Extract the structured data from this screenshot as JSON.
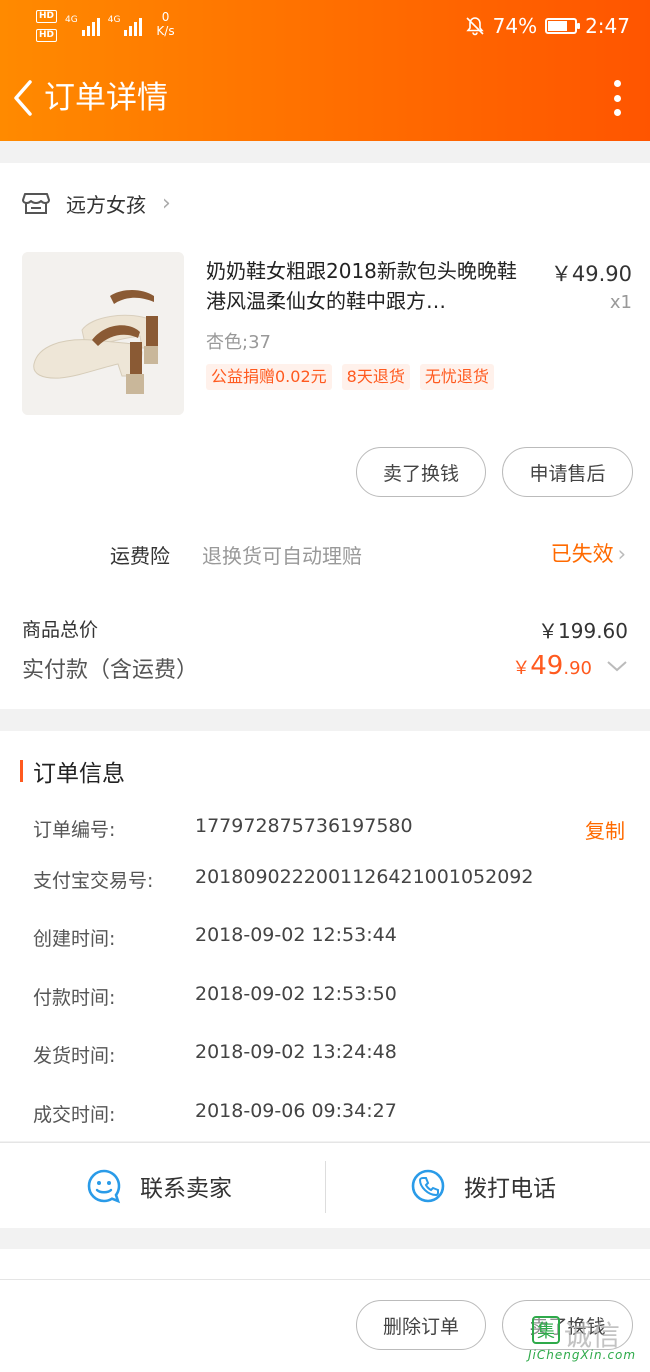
{
  "status_bar": {
    "hd1": "HD",
    "hd2": "HD",
    "net1": "4G",
    "net2": "4G",
    "speed_value": "0",
    "speed_unit": "K/s",
    "battery": "74%",
    "battery_level": 0.74,
    "time": "2:47"
  },
  "header": {
    "title": "订单详情"
  },
  "shop": {
    "name": "远方女孩"
  },
  "item": {
    "title": "奶奶鞋女粗跟2018新款包头晚晚鞋港风温柔仙女的鞋中跟方…",
    "price": "￥49.90",
    "qty": "x1",
    "spec": "杏色;37",
    "tags": [
      "公益捐赠0.02元",
      "8天退货",
      "无忧退货"
    ]
  },
  "item_actions": {
    "sell": "卖了换钱",
    "aftersale": "申请售后"
  },
  "insurance": {
    "label": "运费险",
    "desc": "退换货可自动理赔",
    "status": "已失效"
  },
  "totals": {
    "goods_label": "商品总价",
    "goods_value": "￥199.60",
    "paid_label": "实付款（含运费）",
    "paid_currency": "￥",
    "paid_int": "49",
    "paid_dec": ".90"
  },
  "order_info": {
    "title": "订单信息",
    "copy": "复制",
    "rows": [
      {
        "label": "订单编号:",
        "value": "177972875736197580"
      },
      {
        "label": "支付宝交易号:",
        "value": "2018090222001126421001052092"
      },
      {
        "label": "创建时间:",
        "value": "2018-09-02 12:53:44"
      },
      {
        "label": "付款时间:",
        "value": "2018-09-02 12:53:50"
      },
      {
        "label": "发货时间:",
        "value": "2018-09-02 13:24:48"
      },
      {
        "label": "成交时间:",
        "value": "2018-09-06 09:34:27"
      }
    ]
  },
  "contact": {
    "seller": "联系卖家",
    "phone": "拨打电话"
  },
  "footer": {
    "delete": "删除订单",
    "sell": "卖了换钱"
  },
  "watermark": {
    "icon": "集",
    "text": "诚信",
    "url": "JiChengXin.com"
  },
  "colors": {
    "accent": "#ff6a00",
    "header_start": "#ff8a00",
    "header_end": "#ff5500",
    "link_blue": "#2a9be8"
  }
}
